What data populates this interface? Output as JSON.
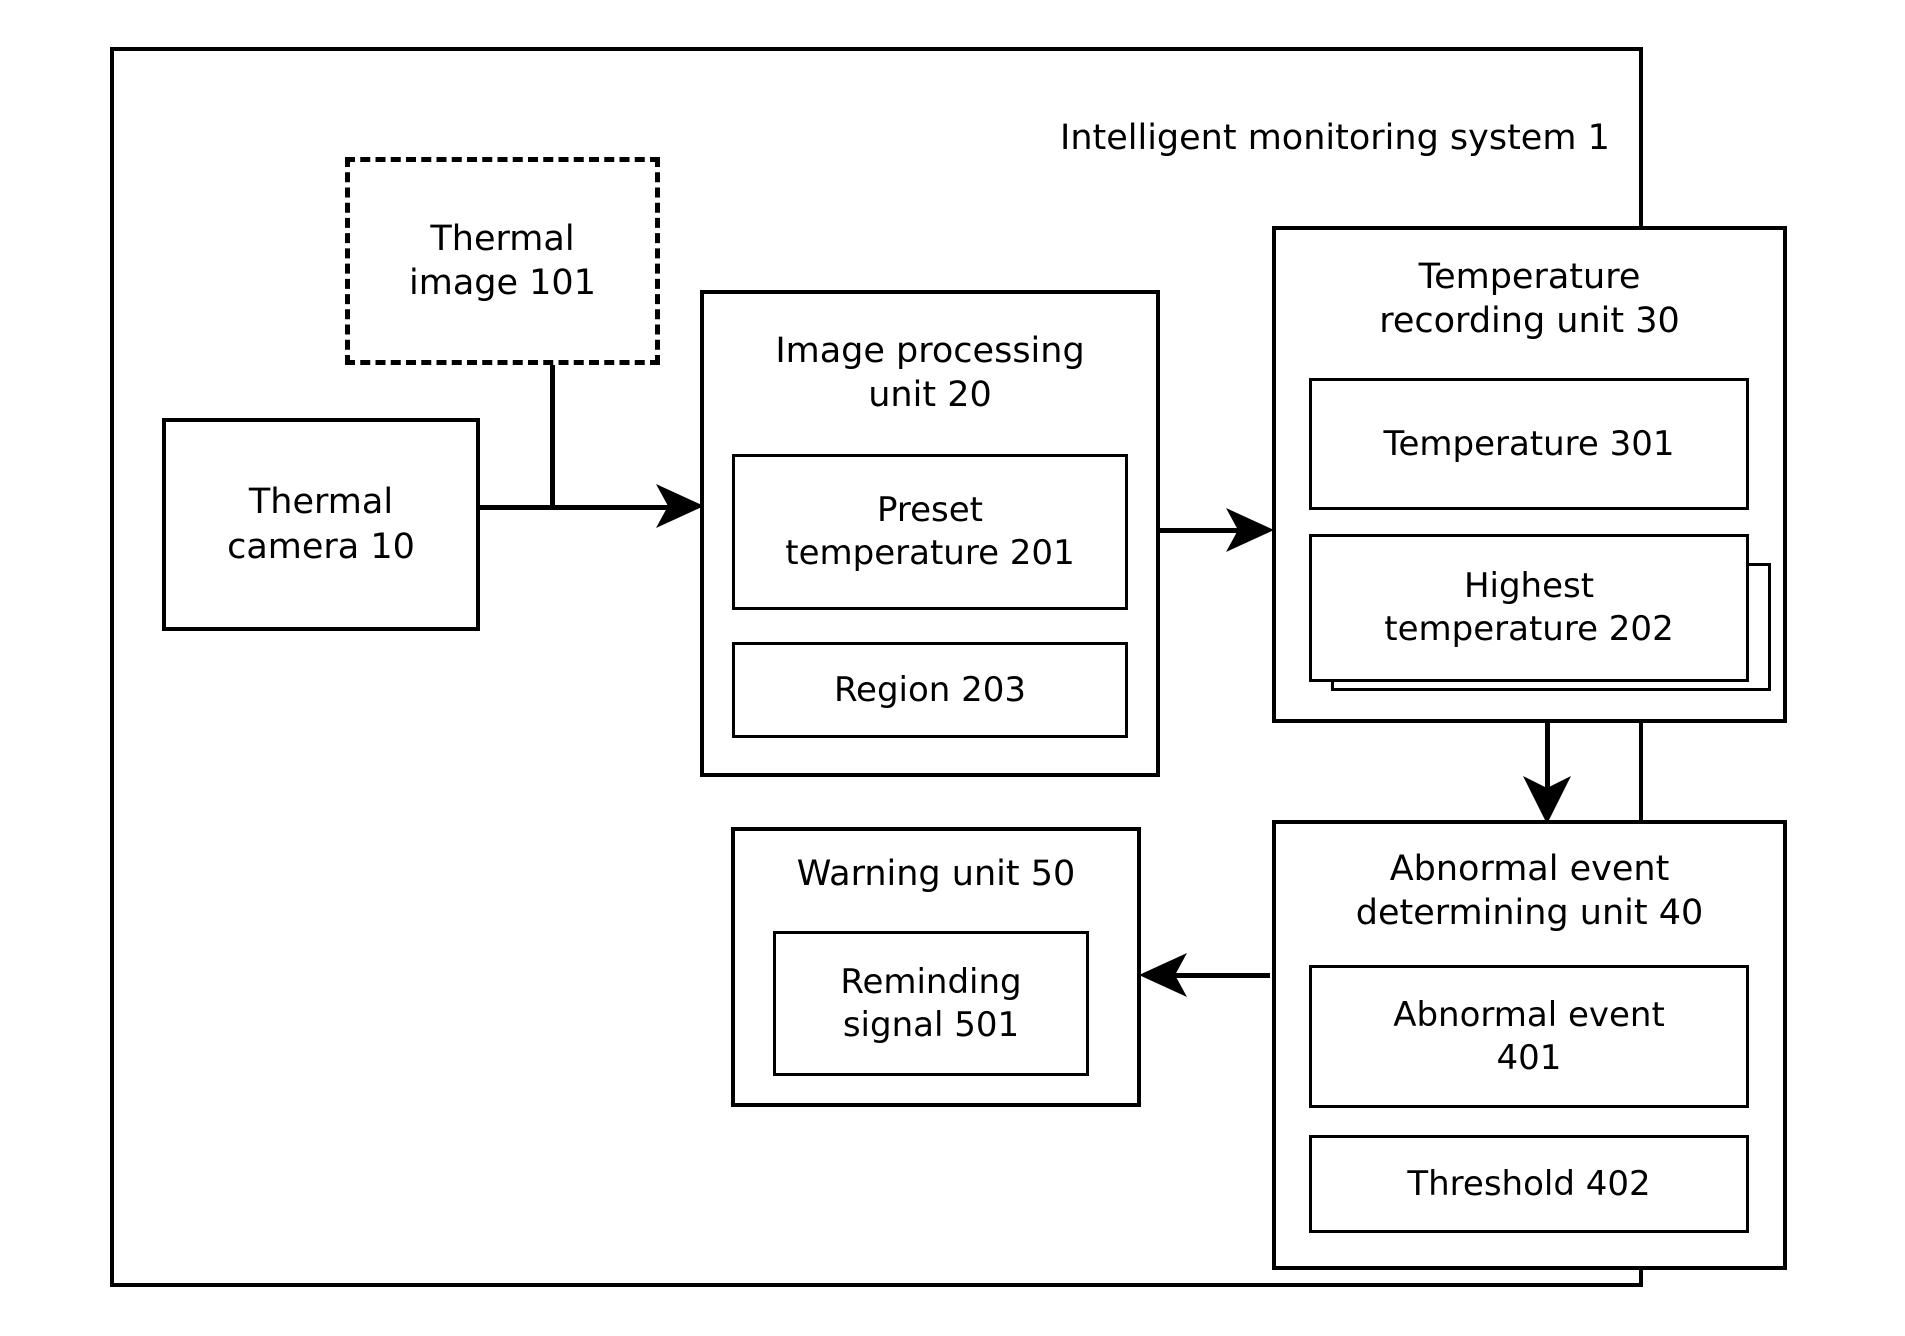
{
  "diagram": {
    "title": "Intelligent monitoring system  1",
    "frame_name": "intelligent-monitoring-system",
    "nodes": {
      "thermal_image": {
        "label": "Thermal\nimage  101",
        "style": "dashed"
      },
      "thermal_camera": {
        "label": "Thermal\ncamera  10"
      },
      "image_processing_unit": {
        "label": "Image processing\nunit   20",
        "children": [
          {
            "label": "Preset\ntemperature 201"
          },
          {
            "label": "Region 203"
          }
        ]
      },
      "temperature_recording_unit": {
        "label": "Temperature\nrecording unit   30",
        "children": [
          {
            "label": "Temperature  301"
          },
          {
            "label": "Highest\ntemperature  202"
          }
        ]
      },
      "abnormal_event_determining_unit": {
        "label": "Abnormal event\ndetermining unit   40",
        "children": [
          {
            "label": "Abnormal event\n401"
          },
          {
            "label": "Threshold  402"
          }
        ]
      },
      "warning_unit": {
        "label": "Warning unit 50",
        "children": [
          {
            "label": "Reminding\nsignal   501"
          }
        ]
      }
    },
    "connections": [
      {
        "name": "camera-to-image-processing",
        "from": "thermal_camera",
        "to": "image_processing_unit",
        "direction": "right"
      },
      {
        "name": "thermal-image-to-link",
        "from": "thermal_image",
        "to": "camera-to-image-processing",
        "direction": "down"
      },
      {
        "name": "image-processing-to-temperature-recording",
        "from": "image_processing_unit",
        "to": "temperature_recording_unit",
        "direction": "right"
      },
      {
        "name": "temperature-recording-to-abnormal-event",
        "from": "temperature_recording_unit",
        "to": "abnormal_event_determining_unit",
        "direction": "down"
      },
      {
        "name": "abnormal-event-to-warning",
        "from": "abnormal_event_determining_unit",
        "to": "warning_unit",
        "direction": "left"
      }
    ],
    "colors": {
      "stroke": "#000000",
      "background": "#ffffff"
    }
  }
}
